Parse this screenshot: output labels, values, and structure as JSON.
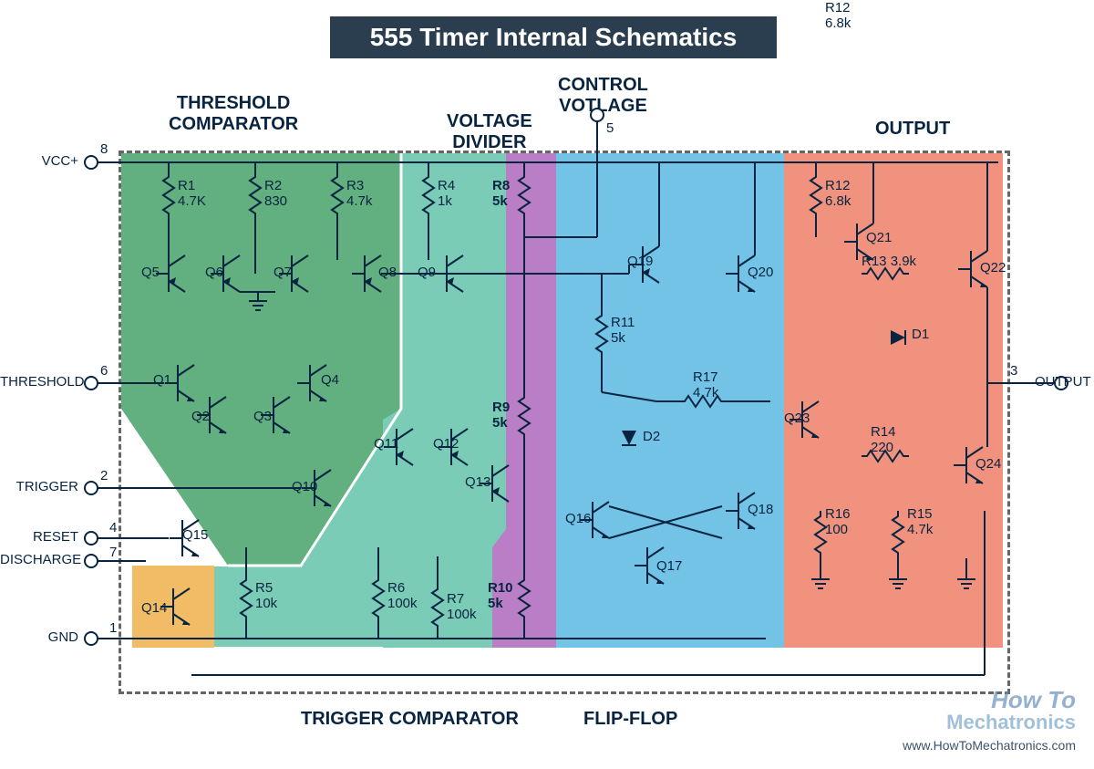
{
  "title": "555 Timer Internal Schematics",
  "sections": {
    "threshold_comparator": "THRESHOLD\nCOMPARATOR",
    "voltage_divider": "VOLTAGE\nDIVIDER",
    "control_voltage": "CONTROL\nVOTLAGE",
    "output": "OUTPUT",
    "trigger_comparator": "TRIGGER COMPARATOR",
    "flip_flop": "FLIP-FLOP"
  },
  "pins": {
    "vcc": {
      "num": "8",
      "label": "VCC+"
    },
    "threshold": {
      "num": "6",
      "label": "THRESHOLD"
    },
    "trigger": {
      "num": "2",
      "label": "TRIGGER"
    },
    "reset": {
      "num": "4",
      "label": "RESET"
    },
    "discharge": {
      "num": "7",
      "label": "DISCHARGE"
    },
    "gnd": {
      "num": "1",
      "label": "GND"
    },
    "control": {
      "num": "5"
    },
    "output": {
      "num": "3",
      "label": "OUTPUT"
    }
  },
  "resistors": {
    "R1": {
      "name": "R1",
      "value": "4.7K"
    },
    "R2": {
      "name": "R2",
      "value": "830"
    },
    "R3": {
      "name": "R3",
      "value": "4.7k"
    },
    "R4": {
      "name": "R4",
      "value": "1k"
    },
    "R5": {
      "name": "R5",
      "value": "10k"
    },
    "R6": {
      "name": "R6",
      "value": "100k"
    },
    "R7": {
      "name": "R7",
      "value": "100k"
    },
    "R8": {
      "name": "R8",
      "value": "5k"
    },
    "R9": {
      "name": "R9",
      "value": "5k"
    },
    "R10": {
      "name": "R10",
      "value": "5k"
    },
    "R11": {
      "name": "R11",
      "value": "5k"
    },
    "R12": {
      "name": "R12",
      "value": "6.8k"
    },
    "R13": {
      "name": "R13",
      "value": "3.9k"
    },
    "R14": {
      "name": "R14",
      "value": "220"
    },
    "R15": {
      "name": "R15",
      "value": "4.7k"
    },
    "R16": {
      "name": "R16",
      "value": "100"
    },
    "R17": {
      "name": "R17",
      "value": "4.7k"
    }
  },
  "transistors": {
    "Q1": "Q1",
    "Q2": "Q2",
    "Q3": "Q3",
    "Q4": "Q4",
    "Q5": "Q5",
    "Q6": "Q6",
    "Q7": "Q7",
    "Q8": "Q8",
    "Q9": "Q9",
    "Q10": "Q10",
    "Q11": "Q11",
    "Q12": "Q12",
    "Q13": "Q13",
    "Q14": "Q14",
    "Q15": "Q15",
    "Q16": "Q16",
    "Q17": "Q17",
    "Q18": "Q18",
    "Q19": "Q19",
    "Q20": "Q20",
    "Q21": "Q21",
    "Q22": "Q22",
    "Q23": "Q23",
    "Q24": "Q24"
  },
  "diodes": {
    "D1": "D1",
    "D2": "D2"
  },
  "colors": {
    "threshold": "#62af7f",
    "trigger": "#7bccb7",
    "divider": "#b97ec6",
    "flipflop": "#72c3e6",
    "output": "#f0927e",
    "discharge": "#f2bb65"
  },
  "watermark": {
    "a": "How To",
    "b": "echatronics",
    "c": "www.HowToMechatronics.com"
  }
}
